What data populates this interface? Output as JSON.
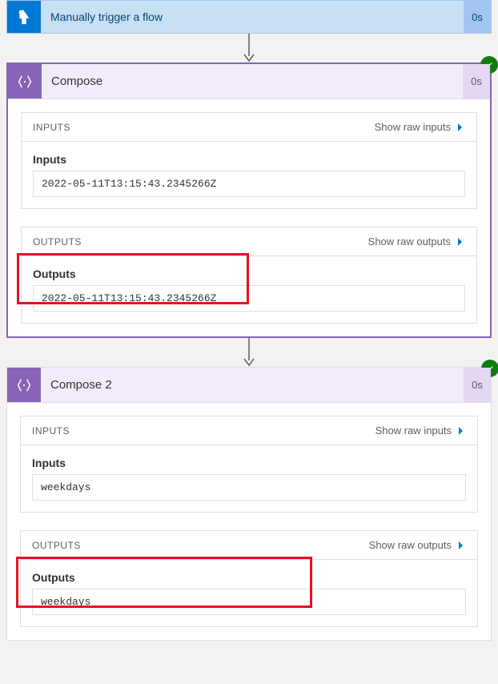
{
  "trigger": {
    "title": "Manually trigger a flow",
    "duration": "0s"
  },
  "actions": [
    {
      "title": "Compose",
      "duration": "0s",
      "status": "success",
      "inputs": {
        "header": "INPUTS",
        "raw_link": "Show raw inputs",
        "field_label": "Inputs",
        "value": "2022-05-11T13:15:43.2345266Z"
      },
      "outputs": {
        "header": "OUTPUTS",
        "raw_link": "Show raw outputs",
        "field_label": "Outputs",
        "value": "2022-05-11T13:15:43.2345266Z"
      }
    },
    {
      "title": "Compose 2",
      "duration": "0s",
      "status": "success",
      "inputs": {
        "header": "INPUTS",
        "raw_link": "Show raw inputs",
        "field_label": "Inputs",
        "value": "weekdays"
      },
      "outputs": {
        "header": "OUTPUTS",
        "raw_link": "Show raw outputs",
        "field_label": "Outputs",
        "value": "weekdays"
      }
    }
  ]
}
